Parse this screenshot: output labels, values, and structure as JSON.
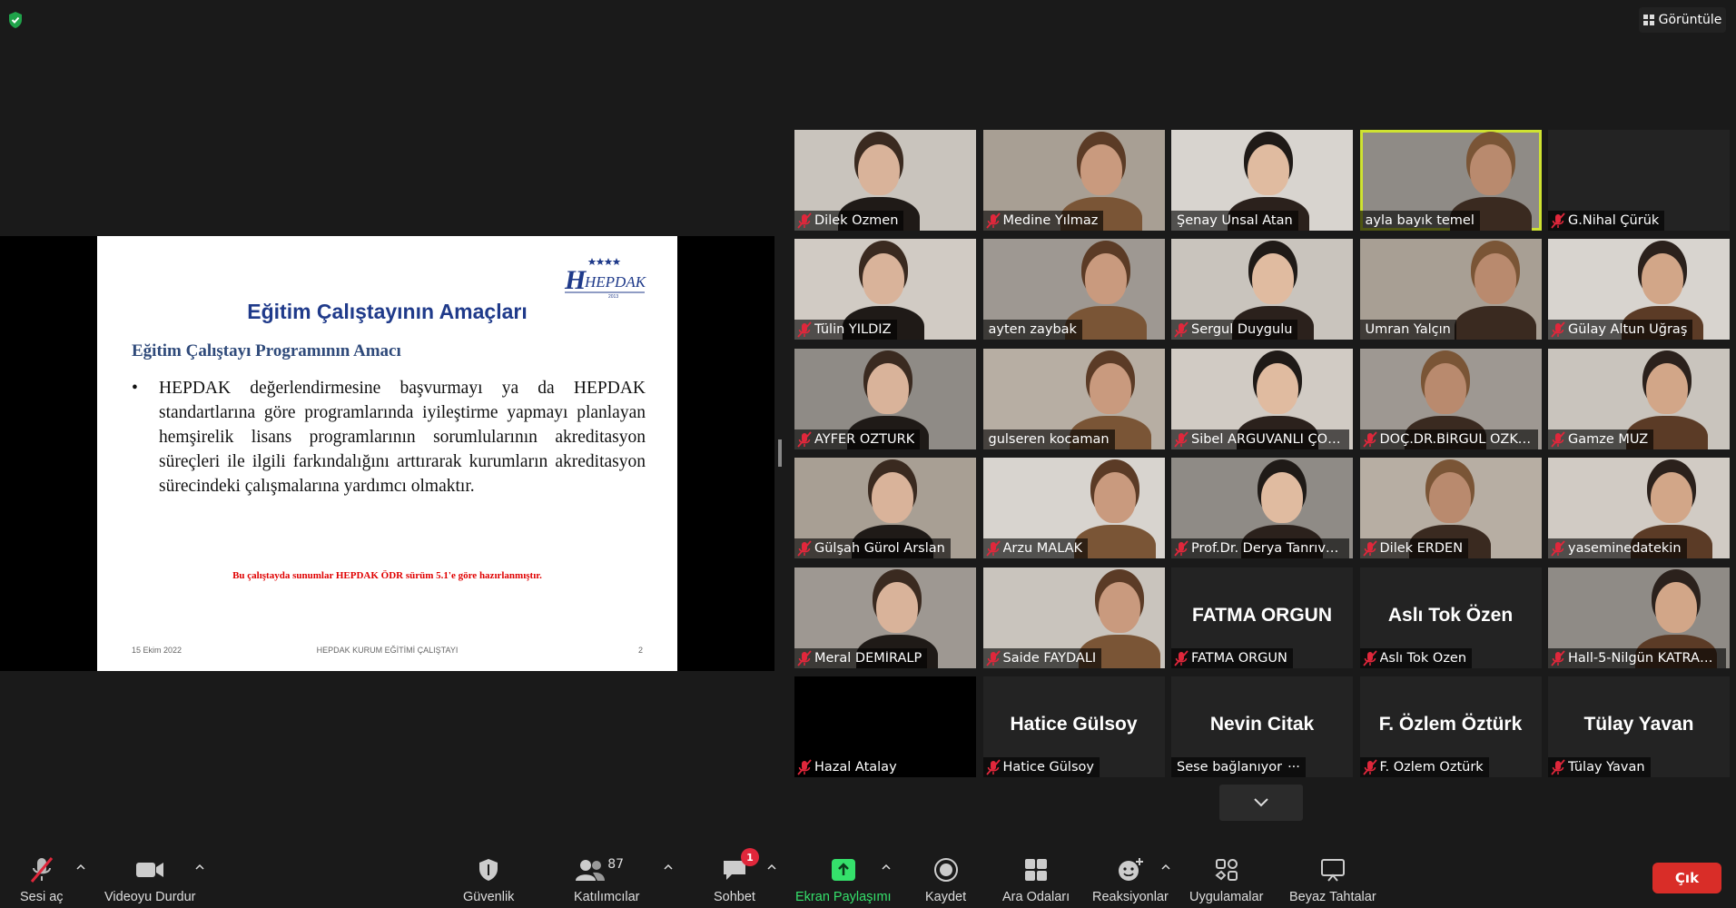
{
  "top_bar": {
    "view_label": "Görüntüle",
    "security_indicator": "shield-check-icon"
  },
  "slide": {
    "logo_text": "HEPDAK",
    "logo_year": "2013",
    "title": "Eğitim Çalıştayının Amaçları",
    "subtitle": "Eğitim Çalıştayı Programının Amacı",
    "bullet": "•",
    "body": "HEPDAK değerlendirmesine başvurmayı ya da HEPDAK standartlarına göre programlarında iyileştirme yapmayı planlayan hemşirelik lisans programlarının sorumlularının akreditasyon süreçleri ile ilgili farkındalığını arttırarak kurumların akreditasyon sürecindeki çalışmalarına yardımcı olmaktır.",
    "note": "Bu çalıştayda sunumlar HEPDAK ÖDR sürüm 5.1'e göre hazırlanmıştır.",
    "footer_date": "15 Ekim 2022",
    "footer_center": "HEPDAK KURUM EĞİTİMİ ÇALIŞTAYI",
    "footer_page": "2"
  },
  "participants": [
    {
      "name": "Dilek Özmen",
      "muted": true,
      "video": true
    },
    {
      "name": "Medine Yılmaz",
      "muted": true,
      "video": true
    },
    {
      "name": "Şenay Ünsal Atan",
      "muted": false,
      "video": true
    },
    {
      "name": "ayla bayık temel",
      "muted": false,
      "video": true,
      "active": true
    },
    {
      "name": "G.Nihal Çürük",
      "muted": true,
      "video": false
    },
    {
      "name": "Tülin YILDIZ",
      "muted": true,
      "video": true
    },
    {
      "name": "ayten zaybak",
      "muted": false,
      "video": true
    },
    {
      "name": "Sergul Duygulu",
      "muted": true,
      "video": true
    },
    {
      "name": "Ümran Yalçın",
      "muted": false,
      "video": true
    },
    {
      "name": "Gülay Altun Uğraş",
      "muted": true,
      "video": true
    },
    {
      "name": "AYFER ÖZTÜRK",
      "muted": true,
      "video": true
    },
    {
      "name": "gulseren kocaman",
      "muted": false,
      "video": true
    },
    {
      "name": "Sibel ARGUVANLI ÇOB...",
      "muted": true,
      "video": true
    },
    {
      "name": "DOÇ.DR.BİRGÜL ÖZKA...",
      "muted": true,
      "video": true
    },
    {
      "name": "Gamze MUZ",
      "muted": true,
      "video": true
    },
    {
      "name": "Gülşah Gürol Arslan",
      "muted": true,
      "video": true
    },
    {
      "name": "Arzu MALAK",
      "muted": true,
      "video": true
    },
    {
      "name": "Prof.Dr. Derya Tanrıver...",
      "muted": true,
      "video": true
    },
    {
      "name": "Dilek ERDEN",
      "muted": true,
      "video": true
    },
    {
      "name": "yaseminedatekin",
      "muted": true,
      "video": true
    },
    {
      "name": "Meral DEMİRALP",
      "muted": true,
      "video": true
    },
    {
      "name": "Saide FAYDALI",
      "muted": true,
      "video": true
    },
    {
      "name": "FATMA ORGUN",
      "muted": true,
      "video": false
    },
    {
      "name": "Aslı Tok Özen",
      "muted": true,
      "video": false
    },
    {
      "name": "Hall-5-Nilgün KATRAN...",
      "muted": true,
      "video": true
    },
    {
      "name": "Hazal Atalay",
      "muted": true,
      "video": false,
      "black": true
    },
    {
      "name": "Hatice Gülsoy",
      "muted": true,
      "video": false
    },
    {
      "name": "Nevin Citak",
      "muted": false,
      "video": false,
      "status": "Sese bağlanıyor"
    },
    {
      "name": "F. Özlem Öztürk",
      "muted": true,
      "video": false
    },
    {
      "name": "Tülay Yavan",
      "muted": true,
      "video": false
    }
  ],
  "toolbar": {
    "unmute": "Sesi aç",
    "stop_video": "Videoyu Durdur",
    "security": "Güvenlik",
    "participants": "Katılımcılar",
    "participants_count": "87",
    "chat": "Sohbet",
    "chat_badge": "1",
    "share_screen": "Ekran Paylaşımı",
    "record": "Kaydet",
    "breakout": "Ara Odaları",
    "reactions": "Reaksiyonlar",
    "apps": "Uygulamalar",
    "whiteboards": "Beyaz Tahtalar",
    "leave": "Çık"
  },
  "colors": {
    "share_green": "#35e06b",
    "leave_red": "#d92d28",
    "active_speaker": "#cfe331",
    "mute_red": "#e0273b",
    "slide_title_blue": "#1f3a8a"
  }
}
